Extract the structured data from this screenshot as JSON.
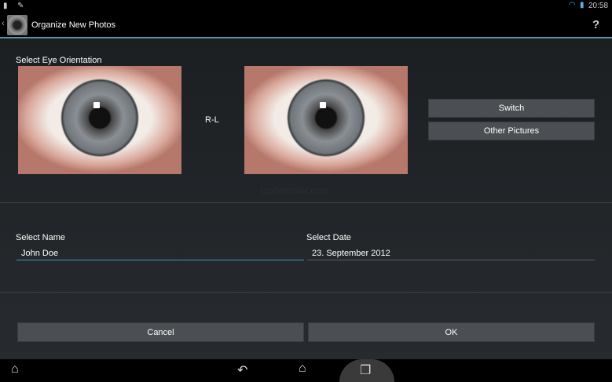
{
  "status_bar": {
    "time": "20:58"
  },
  "action_bar": {
    "title": "Organize New Photos",
    "help": "?"
  },
  "orientation": {
    "label": "Select Eye Orientation",
    "value": "R-L",
    "switch_label": "Switch",
    "other_label": "Other Pictures"
  },
  "watermark": "UpdateStar.com",
  "form": {
    "name_label": "Select Name",
    "name_value": "John Doe",
    "date_label": "Select Date",
    "date_value": "23. September 2012"
  },
  "buttons": {
    "cancel": "Cancel",
    "ok": "OK"
  }
}
